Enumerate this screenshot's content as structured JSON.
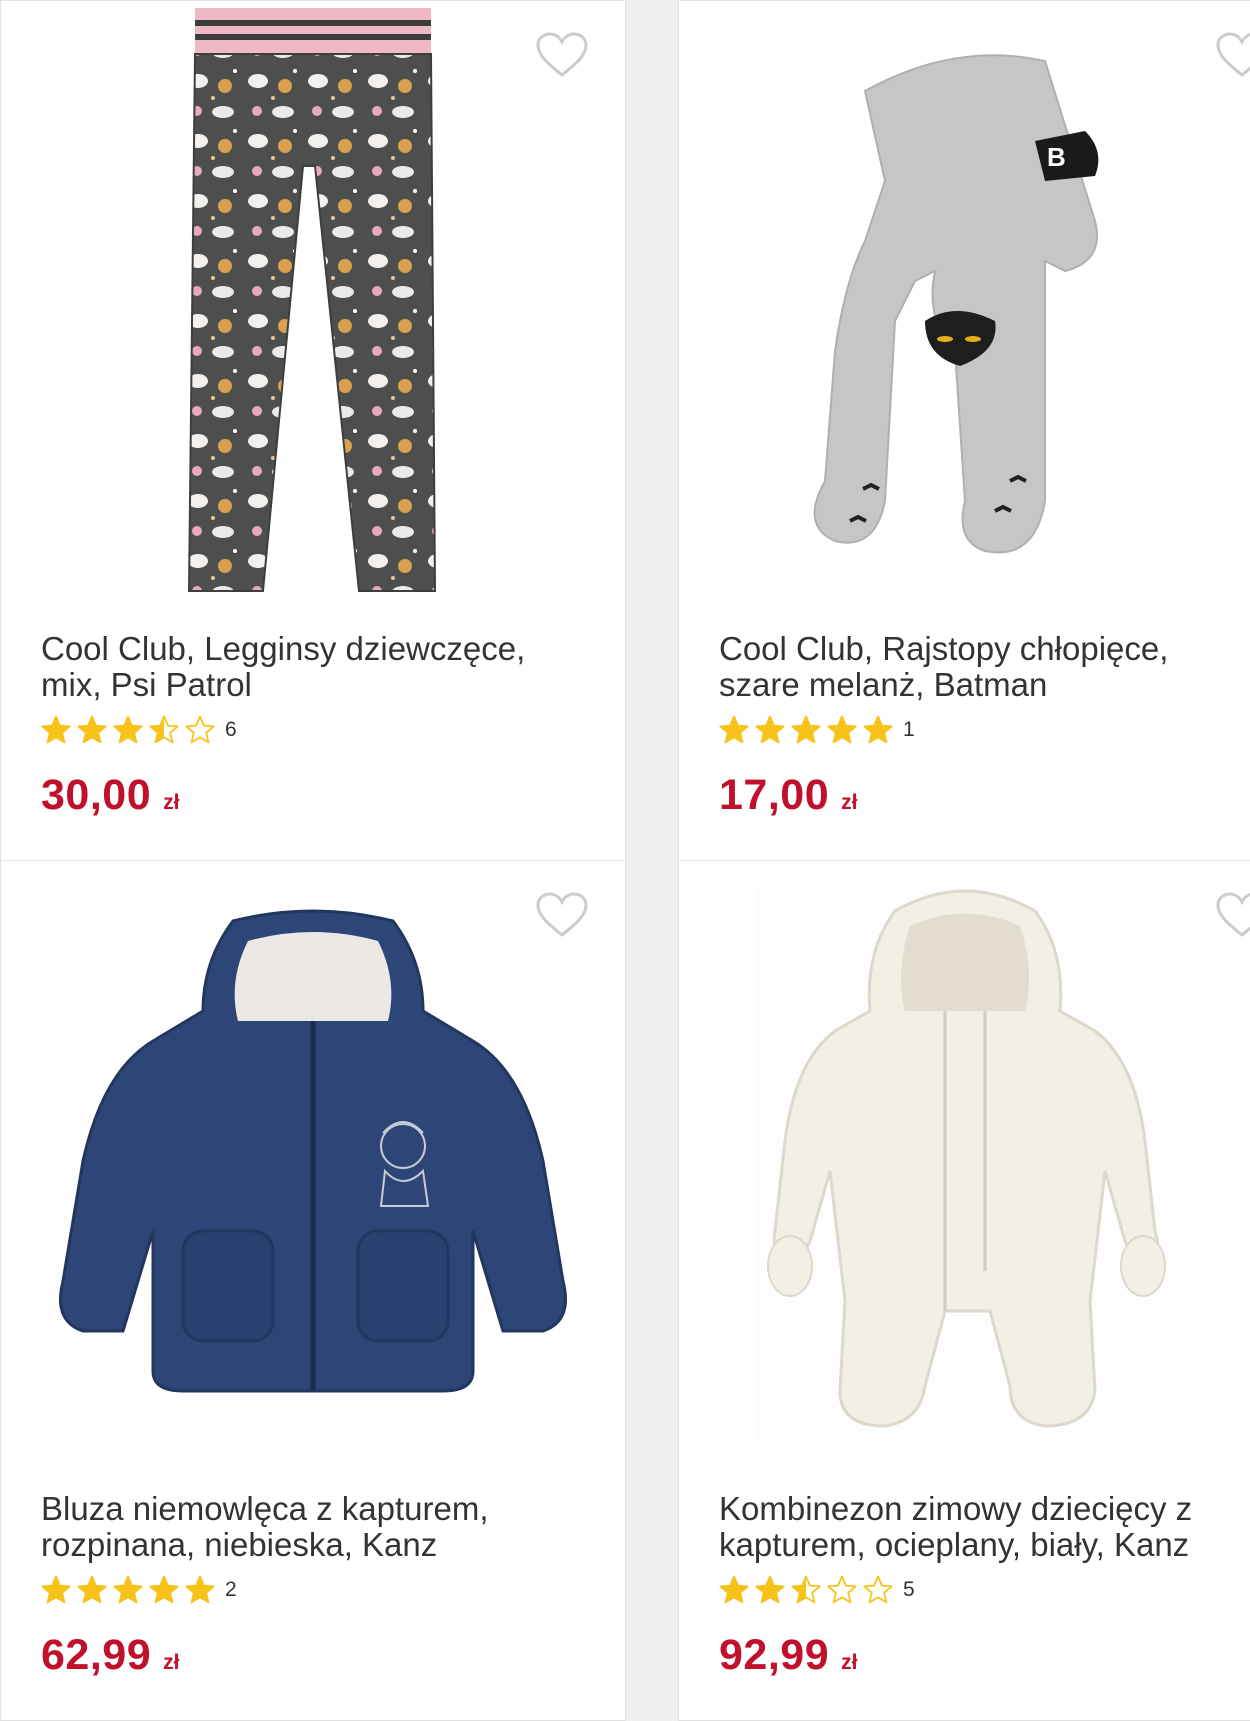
{
  "colors": {
    "price": "#c0102b",
    "star_filled": "#f7c21a",
    "star_empty": "#f7c21a",
    "title_text": "#333333",
    "heart_outline": "#cccccc"
  },
  "products": [
    {
      "title": "Cool Club, Legginsy dziewczęce, mix, Psi Patrol",
      "rating": 3.5,
      "rating_count": "6",
      "price": "30,00",
      "currency": "zł",
      "favorite_icon": "heart-outline-icon",
      "image": "leggings-image"
    },
    {
      "title": "Cool Club, Rajstopy chłopięce, szare melanż, Batman",
      "rating": 5,
      "rating_count": "1",
      "price": "17,00",
      "currency": "zł",
      "favorite_icon": "heart-outline-icon",
      "image": "tights-image"
    },
    {
      "title": "Bluza niemowlęca z kapturem, rozpinana, niebieska, Kanz",
      "rating": 5,
      "rating_count": "2",
      "price": "62,99",
      "currency": "zł",
      "favorite_icon": "heart-outline-icon",
      "image": "hoodie-image"
    },
    {
      "title": "Kombinezon zimowy dziecięcy z kapturem, ocieplany, biały, Kanz",
      "rating": 2.5,
      "rating_count": "5",
      "price": "92,99",
      "currency": "zł",
      "favorite_icon": "heart-outline-icon",
      "image": "snowsuit-image"
    }
  ]
}
